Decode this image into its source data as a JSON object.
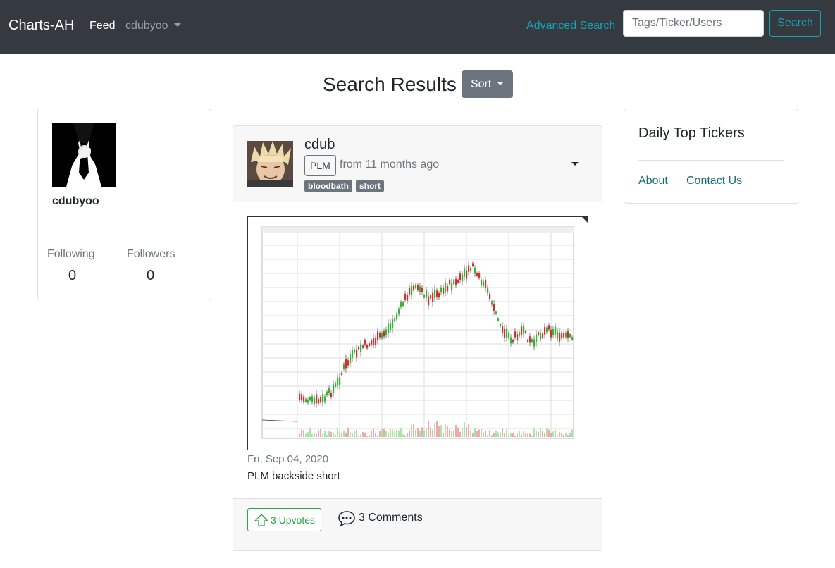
{
  "navbar": {
    "brand": "Charts-AH",
    "feed": "Feed",
    "user": "cdubyoo",
    "advanced_search": "Advanced Search",
    "search_placeholder": "Tags/Ticker/Users",
    "search_button": "Search"
  },
  "page": {
    "title": "Search Results",
    "sort_label": "Sort"
  },
  "profile": {
    "username": "cdubyoo",
    "following_label": "Following",
    "following_count": "0",
    "followers_label": "Followers",
    "followers_count": "0"
  },
  "post": {
    "author": "cdub",
    "ticker": "PLM",
    "time": "from 11 months ago",
    "tags": [
      "bloodbath",
      "short"
    ],
    "date": "Fri, Sep 04, 2020",
    "description": "PLM backside short",
    "upvotes": "3 Upvotes",
    "comments": "3 Comments"
  },
  "sidebar": {
    "title": "Daily Top Tickers",
    "links": [
      "About",
      "Contact Us"
    ]
  },
  "colors": {
    "navbar": "#343a40",
    "accent": "#17a2b8",
    "upvote": "#28a745",
    "tag": "#6c757d"
  }
}
